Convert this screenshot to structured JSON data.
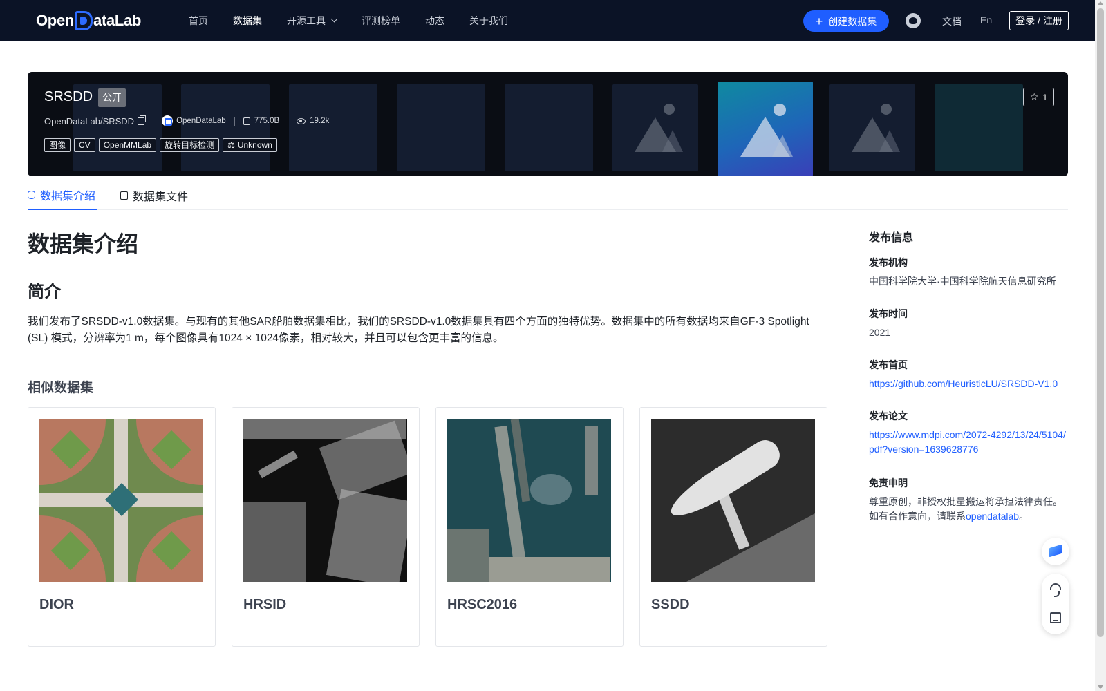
{
  "header": {
    "logo_text_left": "Open",
    "logo_text_right": "ataLab",
    "nav": [
      {
        "label": "首页"
      },
      {
        "label": "数据集"
      },
      {
        "label": "开源工具"
      },
      {
        "label": "评测榜单"
      },
      {
        "label": "动态"
      },
      {
        "label": "关于我们"
      }
    ],
    "create_label": "创建数据集",
    "docs_label": "文档",
    "lang_label": "En",
    "login_label": "登录 / 注册"
  },
  "dataset": {
    "title": "SRSDD",
    "visibility": "公开",
    "path": "OpenDataLab/SRSDD",
    "org": "OpenDataLab",
    "size": "775.0B",
    "views": "19.2k",
    "tags": [
      "图像",
      "CV",
      "OpenMMLab",
      "旋转目标检测"
    ],
    "license": "Unknown",
    "stars": "1"
  },
  "tabs": [
    {
      "label": "数据集介绍"
    },
    {
      "label": "数据集文件"
    }
  ],
  "main": {
    "heading": "数据集介绍",
    "intro_heading": "简介",
    "intro_text": "我们发布了SRSDD-v1.0数据集。与现有的其他SAR船舶数据集相比，我们的SRSDD-v1.0数据集具有四个方面的独特优势。数据集中的所有数据均来自GF-3 Spotlight (SL) 模式，分辨率为1 m，每个图像具有1024 × 1024像素，相对较大，并且可以包含更丰富的信息。",
    "similar_heading": "相似数据集",
    "similar": [
      {
        "name": "DIOR"
      },
      {
        "name": "HRSID"
      },
      {
        "name": "HRSC2016"
      },
      {
        "name": "SSDD"
      }
    ]
  },
  "sidebar": {
    "title": "发布信息",
    "org_label": "发布机构",
    "org_value": "中国科学院大学·中国科学院航天信息研究所",
    "time_label": "发布时间",
    "time_value": "2021",
    "home_label": "发布首页",
    "home_value": "https://github.com/HeuristicLU/SRSDD-V1.0",
    "paper_label": "发布论文",
    "paper_value": "https://www.mdpi.com/2072-4292/13/24/5104/pdf?version=1639628776",
    "disclaimer_label": "免责申明",
    "disclaimer_text_1": "尊重原创，非授权批量搬运将承担法律责任。",
    "disclaimer_text_2": "如有合作意向，请联系",
    "disclaimer_link": "opendatalab",
    "disclaimer_end": "。"
  },
  "colors": {
    "header_bg": "#0b1326",
    "accent": "#1f5eff",
    "banner_bg": "#0a0d14"
  }
}
